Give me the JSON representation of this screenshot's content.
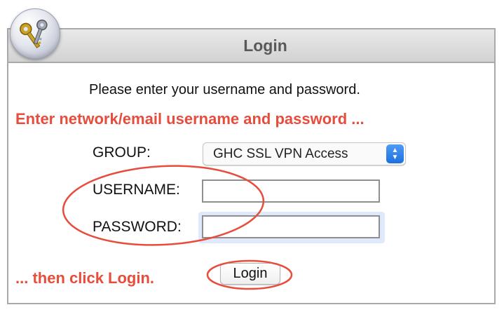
{
  "header": {
    "title": "Login",
    "logo_icon": "keys-icon"
  },
  "instructions": "Please enter your username and password.",
  "hints": {
    "top": "Enter network/email username and password ...",
    "bottom": "... then click Login.",
    "color": "#e74c3c"
  },
  "form": {
    "group_label": "GROUP:",
    "group_value": "GHC SSL VPN Access",
    "username_label": "USERNAME:",
    "username_value": "",
    "password_label": "PASSWORD:",
    "password_value": "",
    "login_label": "Login"
  }
}
